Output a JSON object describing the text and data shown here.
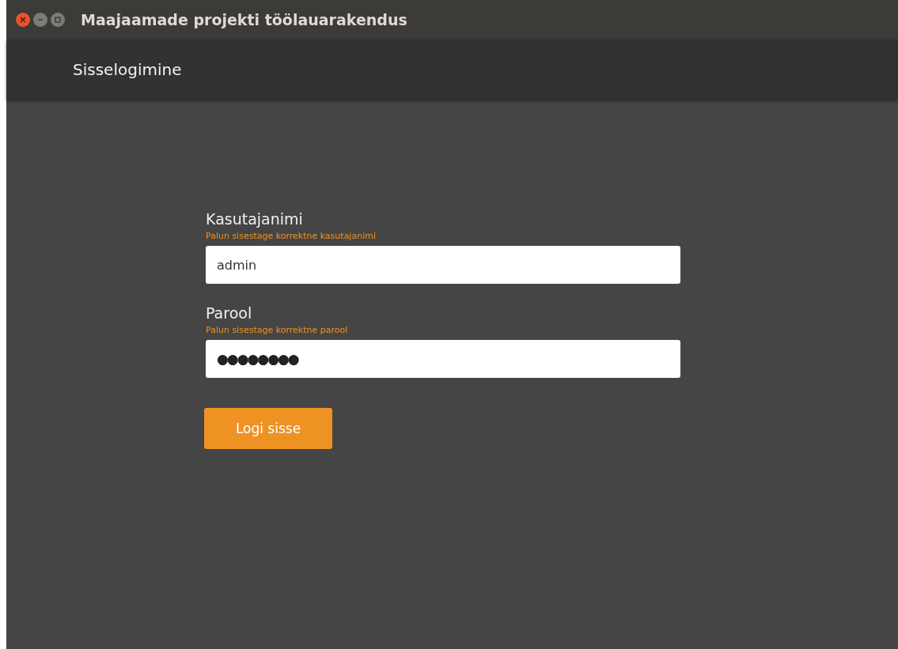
{
  "window": {
    "title": "Maajaamade projekti töölauarakendus"
  },
  "header": {
    "title": "Sisselogimine"
  },
  "fields": [
    {
      "label": "Kasutajanimi",
      "hint": "Palun sisestage korrektne kasutajanimi",
      "value": "admin",
      "kind": "text"
    },
    {
      "label": "Parool",
      "hint": "Palun sisestage korrektne parool",
      "value": "●●●●●●●●",
      "kind": "password"
    }
  ],
  "button": {
    "label": "Logi sisse"
  }
}
